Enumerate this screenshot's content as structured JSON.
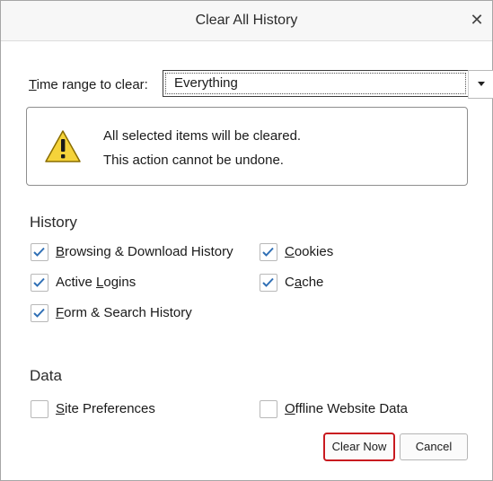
{
  "dialog": {
    "title": "Clear All History",
    "close_icon": "close-icon"
  },
  "time_range": {
    "label_mnemonic": "T",
    "label_rest": "ime range to clear:",
    "selected": "Everything"
  },
  "warning": {
    "icon": "warning-icon",
    "line1": "All selected items will be cleared.",
    "line2": "This action cannot be undone."
  },
  "history": {
    "heading": "History",
    "items": [
      {
        "pre": "",
        "key": "B",
        "post": "rowsing & Download History",
        "checked": true
      },
      {
        "pre": "",
        "key": "C",
        "post": "ookies",
        "checked": true
      },
      {
        "pre": "Active ",
        "key": "L",
        "post": "ogins",
        "checked": true
      },
      {
        "pre": "C",
        "key": "a",
        "post": "che",
        "checked": true
      },
      {
        "pre": "",
        "key": "F",
        "post": "orm & Search History",
        "checked": true
      }
    ]
  },
  "data_section": {
    "heading": "Data",
    "items": [
      {
        "pre": "",
        "key": "S",
        "post": "ite Preferences",
        "checked": false
      },
      {
        "pre": "",
        "key": "O",
        "post": "ffline Website Data",
        "checked": false
      }
    ]
  },
  "buttons": {
    "clear_now": "Clear Now",
    "cancel": "Cancel"
  },
  "colors": {
    "highlight_border": "#c8191f",
    "check": "#2f6fb5",
    "warning_fill": "#f5d33a"
  }
}
